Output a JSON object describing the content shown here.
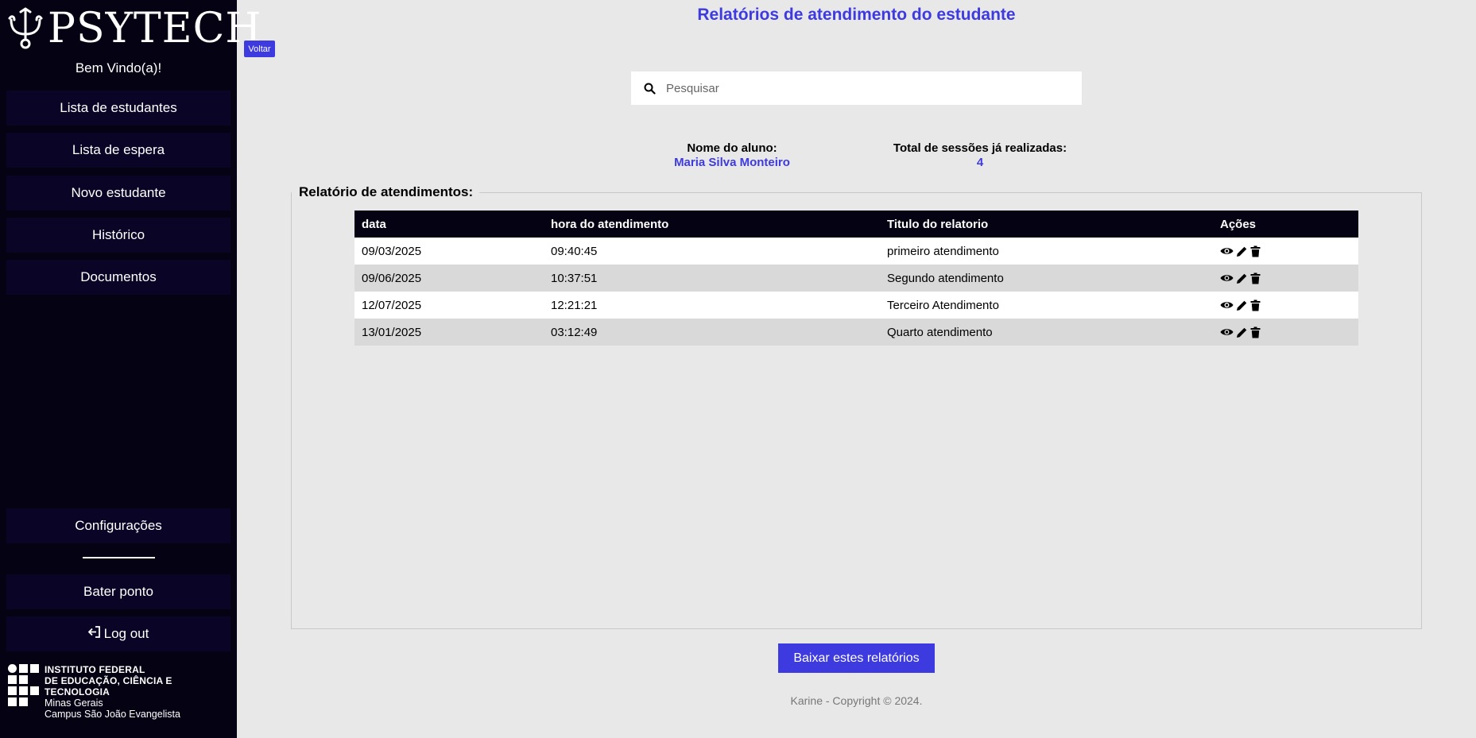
{
  "sidebar": {
    "logo_text": "PSYTECH",
    "welcome": "Bem Vindo(a)!",
    "items": [
      {
        "label": "Lista de estudantes"
      },
      {
        "label": "Lista de espera"
      },
      {
        "label": "Novo estudante"
      },
      {
        "label": "Histórico"
      },
      {
        "label": "Documentos"
      }
    ],
    "bottom_items": {
      "settings": "Configurações",
      "clock": "Bater ponto",
      "logout": "Log out"
    },
    "institution": {
      "line1": "INSTITUTO FEDERAL",
      "line2": "DE EDUCAÇÃO, CIÊNCIA E TECNOLOGIA",
      "line3": "Minas Gerais",
      "line4": "Campus São João Evangelista"
    }
  },
  "header": {
    "title": "Relatórios de atendimento do estudante",
    "back_label": "Voltar"
  },
  "search": {
    "placeholder": "Pesquisar",
    "value": ""
  },
  "student": {
    "name_label": "Nome do aluno:",
    "name": "Maria Silva Monteiro",
    "sessions_label": "Total de sessões já realizadas:",
    "sessions": "4"
  },
  "reports": {
    "legend": "Relatório de atendimentos:",
    "columns": [
      "data",
      "hora do atendimento",
      "Titulo do relatorio",
      "Ações"
    ],
    "rows": [
      [
        "09/03/2025",
        "09:40:45",
        "primeiro atendimento"
      ],
      [
        "09/06/2025",
        "10:37:51",
        "Segundo atendimento"
      ],
      [
        "12/07/2025",
        "12:21:21",
        "Terceiro Atendimento"
      ],
      [
        "13/01/2025",
        "03:12:49",
        "Quarto atendimento"
      ]
    ],
    "row_actions": [
      "eye-icon",
      "pencil-icon",
      "trash-icon"
    ]
  },
  "download_label": "Baixar estes relatórios",
  "footer": "Karine - Copyright © 2024.",
  "colors": {
    "accent": "#3d3ae0",
    "sidebar_bg": "#050214",
    "nav_item_bg": "#0a0526",
    "page_bg": "#e8e8e8"
  }
}
